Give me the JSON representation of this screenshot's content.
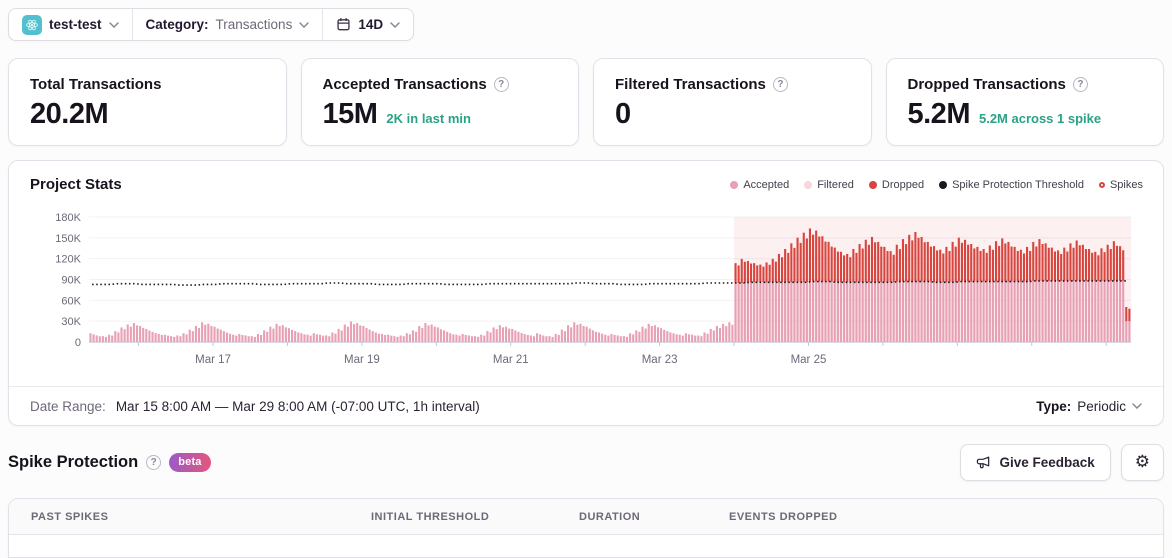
{
  "topbar": {
    "project_name": "test-test",
    "category_label": "Category:",
    "category_value": "Transactions",
    "date_range_value": "14D"
  },
  "stat_cards": [
    {
      "title": "Total Transactions",
      "value": "20.2M",
      "subtext": "",
      "has_help": false
    },
    {
      "title": "Accepted Transactions",
      "value": "15M",
      "subtext": "2K in last min",
      "has_help": true
    },
    {
      "title": "Filtered Transactions",
      "value": "0",
      "subtext": "",
      "has_help": true
    },
    {
      "title": "Dropped Transactions",
      "value": "5.2M",
      "subtext": "5.2M across 1 spike",
      "has_help": true
    }
  ],
  "chart": {
    "title": "Project Stats",
    "legend": [
      {
        "label": "Accepted",
        "shape": "dot",
        "color": "#e7a0b4"
      },
      {
        "label": "Filtered",
        "shape": "dot",
        "color": "#f8d7dc"
      },
      {
        "label": "Dropped",
        "shape": "dot",
        "color": "#d8453e"
      },
      {
        "label": "Spike Protection Threshold",
        "shape": "dot",
        "color": "#1d1721"
      },
      {
        "label": "Spikes",
        "shape": "ring",
        "color": "#d8453e"
      }
    ]
  },
  "chart_data": {
    "type": "bar",
    "stacked": true,
    "title": "Project Stats",
    "units": "transactions (values in thousands)",
    "x_axis": "time, Mar 15 8:00 AM to Mar 29 8:00 AM (-07:00 UTC), 1h interval",
    "x_range_hours": 336,
    "point_interval_hours": 2,
    "ylim_k": [
      0,
      180
    ],
    "ytick_values_k": [
      0,
      30,
      60,
      90,
      120,
      150,
      180
    ],
    "ytick_labels": [
      "0",
      "30K",
      "60K",
      "90K",
      "120K",
      "150K",
      "180K"
    ],
    "xticks": [
      {
        "label": "Mar 17",
        "hour": 40
      },
      {
        "label": "Mar 19",
        "hour": 88
      },
      {
        "label": "Mar 21",
        "hour": 136
      },
      {
        "label": "Mar 23",
        "hour": 184
      },
      {
        "label": "Mar 25",
        "hour": 232
      }
    ],
    "spike_region": {
      "start_index": 104,
      "end_index": 168,
      "fill": "rgba(216,69,62,0.08)"
    },
    "series": [
      {
        "name": "Accepted",
        "color": "#e7a0b4",
        "values": [
          12,
          9,
          8,
          10,
          15,
          20,
          24,
          26,
          22,
          18,
          14,
          11,
          10,
          8,
          9,
          12,
          17,
          22,
          27,
          25,
          21,
          17,
          13,
          10,
          11,
          9,
          8,
          11,
          16,
          21,
          25,
          23,
          19,
          15,
          12,
          10,
          12,
          10,
          9,
          13,
          18,
          24,
          28,
          26,
          22,
          17,
          13,
          11,
          10,
          8,
          9,
          12,
          16,
          22,
          26,
          24,
          20,
          16,
          12,
          10,
          11,
          9,
          8,
          10,
          15,
          20,
          23,
          21,
          18,
          14,
          11,
          9,
          12,
          9,
          8,
          11,
          17,
          23,
          27,
          25,
          21,
          16,
          13,
          10,
          11,
          9,
          8,
          12,
          16,
          21,
          25,
          23,
          19,
          15,
          12,
          10,
          12,
          10,
          9,
          13,
          18,
          22,
          25,
          27,
          85,
          85,
          86,
          86,
          86,
          86,
          86,
          86,
          86,
          86,
          86,
          86,
          87,
          87,
          87,
          87,
          86,
          86,
          86,
          86,
          86,
          86,
          86,
          86,
          86,
          86,
          87,
          87,
          87,
          87,
          87,
          87,
          86,
          86,
          86,
          86,
          87,
          87,
          87,
          87,
          87,
          87,
          87,
          87,
          87,
          87,
          87,
          87,
          88,
          88,
          88,
          88,
          88,
          88,
          88,
          88,
          88,
          88,
          88,
          88,
          88,
          88,
          88,
          30
        ]
      },
      {
        "name": "Filtered",
        "color": "#f8d7dc",
        "constant": 0
      },
      {
        "name": "Dropped",
        "color": "#d8453e",
        "values": [
          0,
          0,
          0,
          0,
          0,
          0,
          0,
          0,
          0,
          0,
          0,
          0,
          0,
          0,
          0,
          0,
          0,
          0,
          0,
          0,
          0,
          0,
          0,
          0,
          0,
          0,
          0,
          0,
          0,
          0,
          0,
          0,
          0,
          0,
          0,
          0,
          0,
          0,
          0,
          0,
          0,
          0,
          0,
          0,
          0,
          0,
          0,
          0,
          0,
          0,
          0,
          0,
          0,
          0,
          0,
          0,
          0,
          0,
          0,
          0,
          0,
          0,
          0,
          0,
          0,
          0,
          0,
          0,
          0,
          0,
          0,
          0,
          0,
          0,
          0,
          0,
          0,
          0,
          0,
          0,
          0,
          0,
          0,
          0,
          0,
          0,
          0,
          0,
          0,
          0,
          0,
          0,
          0,
          0,
          0,
          0,
          0,
          0,
          0,
          0,
          0,
          0,
          0,
          0,
          28,
          34,
          30,
          27,
          25,
          28,
          33,
          40,
          47,
          55,
          63,
          70,
          75,
          72,
          64,
          56,
          49,
          43,
          40,
          47,
          54,
          60,
          64,
          57,
          50,
          44,
          52,
          60,
          66,
          70,
          63,
          56,
          51,
          46,
          50,
          57,
          62,
          59,
          53,
          49,
          46,
          51,
          57,
          61,
          56,
          49,
          45,
          49,
          55,
          59,
          53,
          47,
          43,
          47,
          53,
          57,
          51,
          45,
          41,
          46,
          51,
          56,
          49,
          20
        ]
      },
      {
        "name": "Spike Protection Threshold",
        "color": "#1d1721",
        "style": "dotted",
        "values": [
          83,
          83,
          83,
          83,
          84,
          84,
          84,
          84,
          83,
          83,
          83,
          83,
          83,
          83,
          82,
          82,
          82,
          82,
          83,
          83,
          83,
          84,
          84,
          84,
          84,
          84,
          84,
          83,
          83,
          83,
          83,
          83,
          84,
          84,
          84,
          84,
          84,
          84,
          85,
          85,
          85,
          84,
          84,
          84,
          84,
          84,
          83,
          83,
          83,
          83,
          83,
          84,
          84,
          84,
          84,
          84,
          84,
          83,
          83,
          83,
          83,
          83,
          83,
          83,
          84,
          84,
          84,
          84,
          84,
          84,
          84,
          84,
          84,
          84,
          84,
          84,
          84,
          84,
          85,
          85,
          85,
          84,
          84,
          84,
          84,
          83,
          83,
          83,
          83,
          83,
          84,
          84,
          84,
          84,
          84,
          84,
          84,
          84,
          84,
          85,
          85,
          85,
          85,
          85,
          85,
          85,
          86,
          86,
          86,
          86,
          86,
          86,
          86,
          86,
          86,
          86,
          87,
          87,
          87,
          87,
          86,
          86,
          86,
          86,
          86,
          86,
          86,
          86,
          86,
          86,
          87,
          87,
          87,
          87,
          87,
          87,
          86,
          86,
          86,
          86,
          87,
          87,
          87,
          87,
          87,
          87,
          87,
          87,
          87,
          87,
          87,
          87,
          88,
          88,
          88,
          88,
          88,
          88,
          88,
          88,
          88,
          88,
          88,
          88,
          88,
          88,
          88,
          88
        ]
      }
    ]
  },
  "footer": {
    "date_range_label": "Date Range:",
    "date_range_value": "Mar 15 8:00 AM — Mar 29 8:00 AM (-07:00 UTC, 1h interval)",
    "type_label": "Type:",
    "type_value": "Periodic"
  },
  "spike_section": {
    "title": "Spike Protection",
    "beta_label": "beta",
    "feedback_label": "Give Feedback"
  },
  "table": {
    "columns": [
      "PAST SPIKES",
      "INITIAL THRESHOLD",
      "DURATION",
      "EVENTS DROPPED"
    ]
  },
  "icons": {
    "gear": "⚙",
    "help": "?"
  },
  "colors": {
    "stat_subtext_teal": "#2ba185",
    "beta_gradient_start": "#9a5bc8",
    "beta_gradient_end": "#e5567b",
    "platform_icon_bg": "#52c0ce",
    "axis_text": "#6f6878"
  }
}
